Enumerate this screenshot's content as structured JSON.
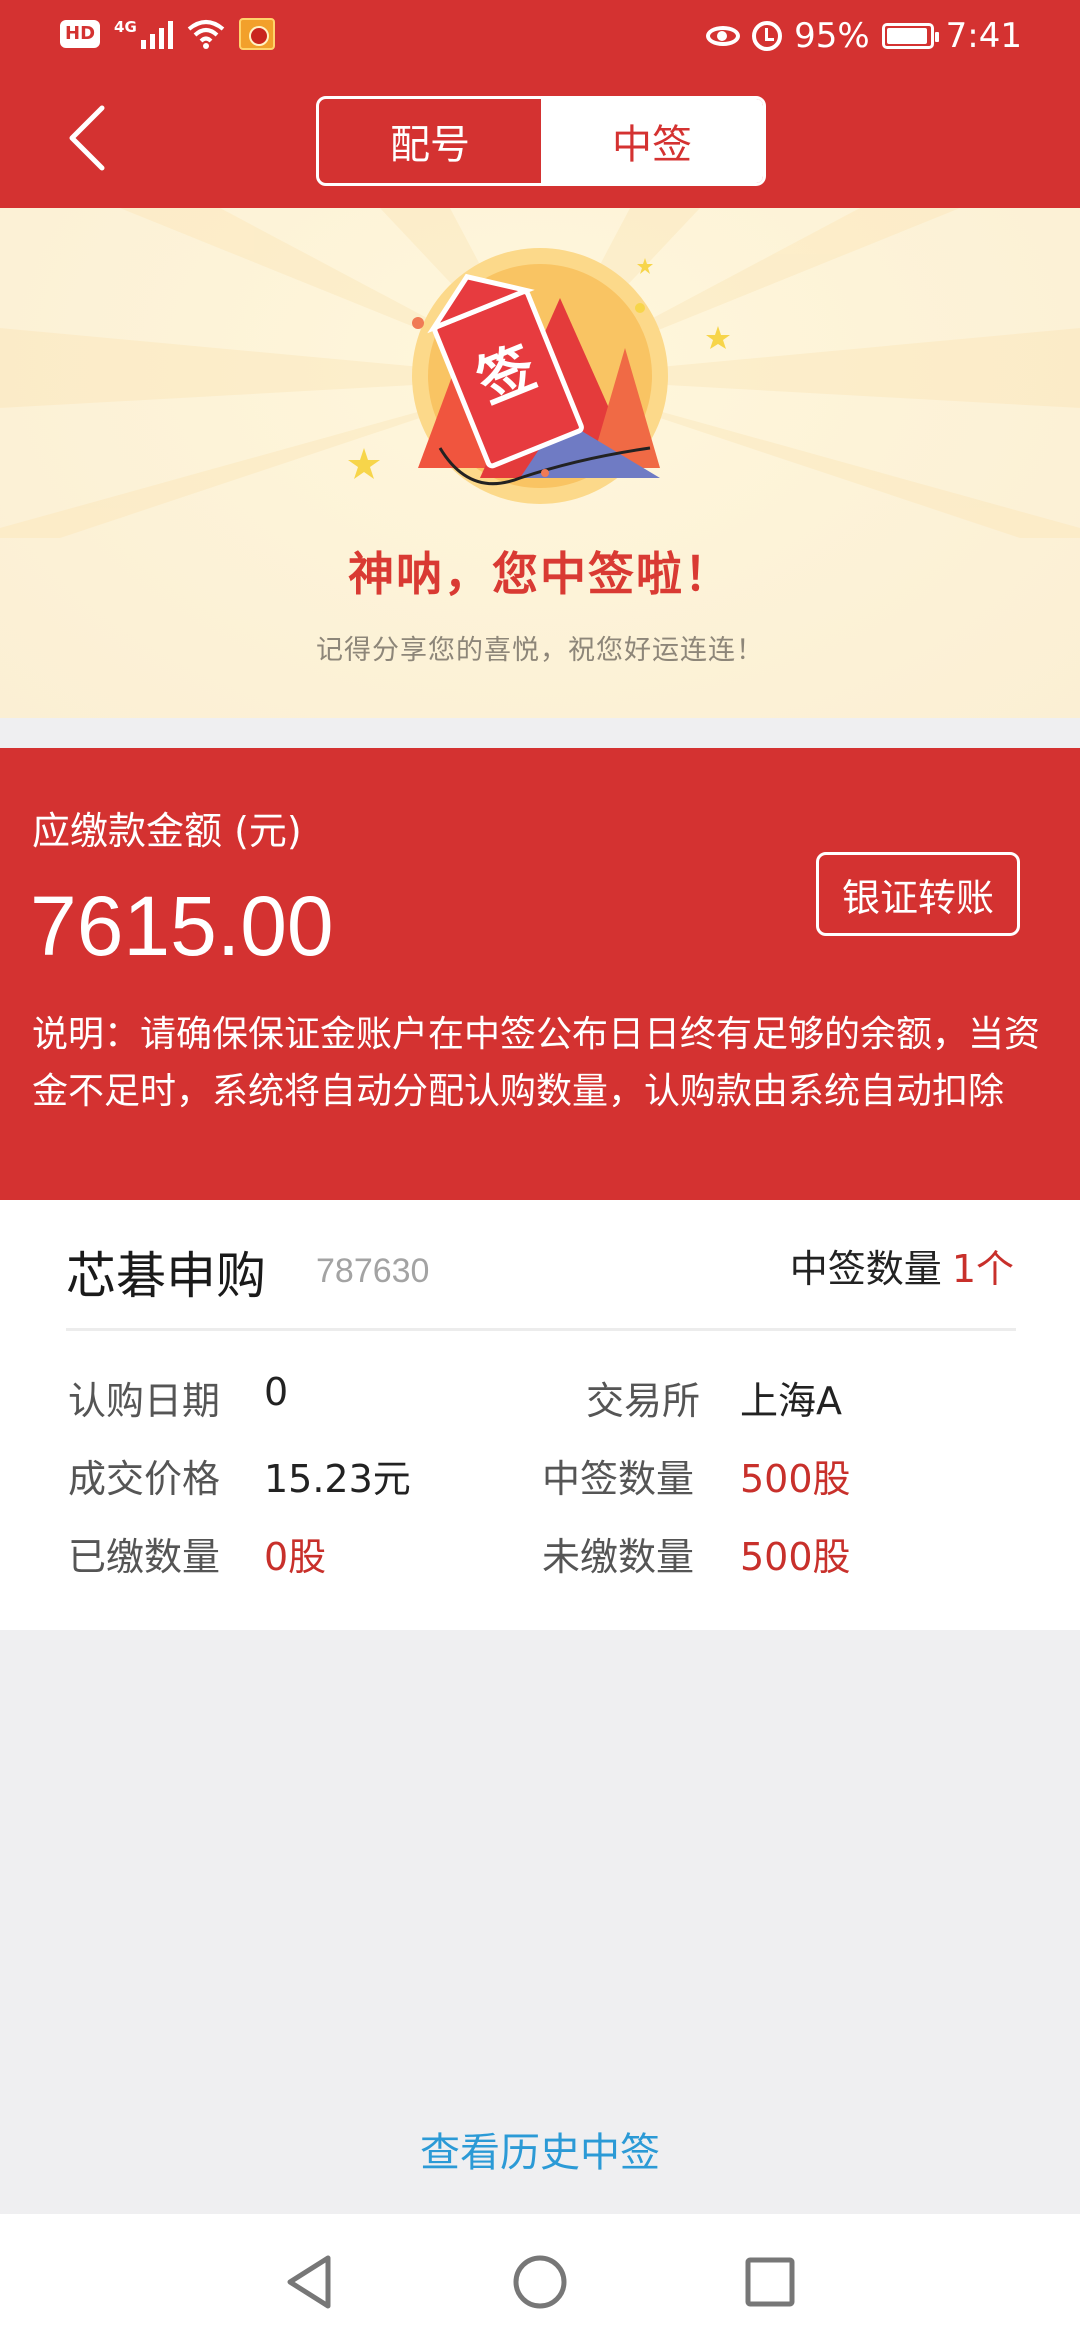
{
  "status_bar": {
    "hd": "HD",
    "network": "4G",
    "battery": "95%",
    "battery_level": 0.95,
    "time": "7:41",
    "icons": [
      "signal-icon",
      "wifi-icon",
      "app-notification-icon",
      "eye-icon",
      "alarm-icon",
      "battery-icon"
    ]
  },
  "nav": {
    "tabs": [
      {
        "label": "配号",
        "active": false
      },
      {
        "label": "中签",
        "active": true
      }
    ]
  },
  "banner": {
    "stamp_char": "签",
    "title": "神呐，您中签啦！",
    "subtitle": "记得分享您的喜悦，祝您好运连连！"
  },
  "payment": {
    "label": "应缴款金额 (元)",
    "amount": "7615.00",
    "transfer_button": "银证转账",
    "note": "说明：请确保保证金账户在中签公布日日终有足够的余额，当资金不足时，系统将自动分配认购数量，认购款由系统自动扣除"
  },
  "stock": {
    "name": "芯碁申购",
    "code": "787630",
    "winning_label": "中签数量",
    "winning_value": "1个",
    "fields": [
      {
        "label": "认购日期",
        "value": "0",
        "red": false
      },
      {
        "label": "交易所",
        "value": "上海A",
        "red": false
      },
      {
        "label": "成交价格",
        "value": "15.23元",
        "red": false
      },
      {
        "label": "中签数量",
        "value": "500股",
        "red": true
      },
      {
        "label": "已缴数量",
        "value": "0股",
        "red": true
      },
      {
        "label": "未缴数量",
        "value": "500股",
        "red": true
      }
    ]
  },
  "history_link": "查看历史中签",
  "colors": {
    "brand_red": "#d43231",
    "value_red": "#c8302b",
    "link_blue": "#2b9ad6",
    "page_bg": "#efeff1"
  }
}
